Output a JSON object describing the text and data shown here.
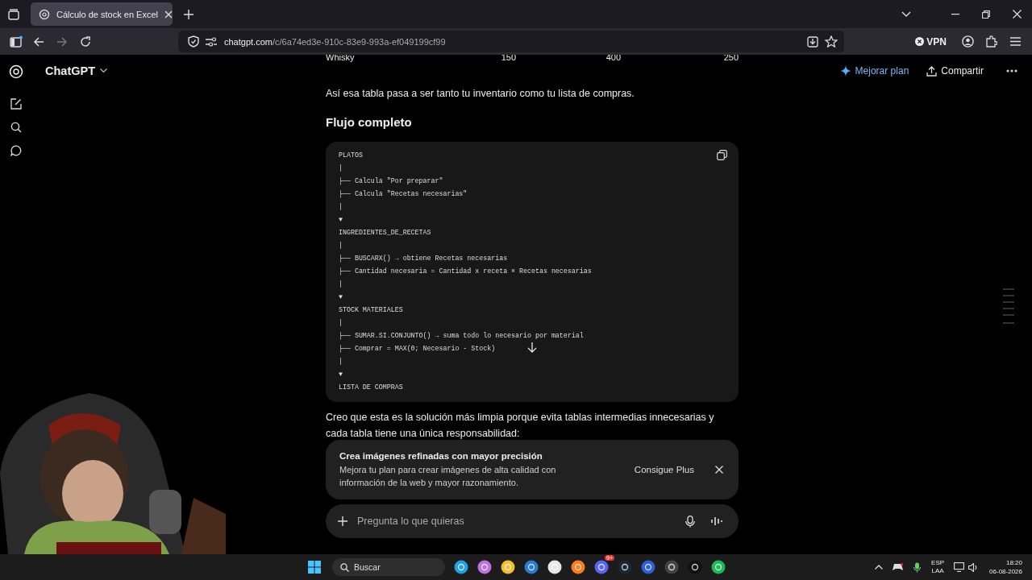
{
  "browser": {
    "tab_title": "Cálculo de stock en Excel",
    "url_domain": "chatgpt.com",
    "url_path": "/c/6a74ed3e-910c-83e9-993a-ef049199cf99",
    "vpn_label": "VPN",
    "forward_disabled": true
  },
  "header": {
    "model": "ChatGPT",
    "upgrade": "Mejorar plan",
    "share": "Compartir"
  },
  "table_row": [
    "Whisky",
    "150",
    "400",
    "250"
  ],
  "paragraph_1": "Así esa tabla pasa a ser tanto tu inventario como tu lista de compras.",
  "heading": "Flujo completo",
  "code_lines": [
    "PLATOS",
    "|",
    "├── Calcula \"Por preparar\"",
    "├── Calcula \"Recetas necesarias\"",
    "|",
    "▼",
    "INGREDIENTES_DE_RECETAS",
    "|",
    "├── BUSCARX() → obtiene Recetas necesarias",
    "├── Cantidad necesaria = Cantidad x receta × Recetas necesarias",
    "|",
    "▼",
    "STOCK MATERIALES",
    "|",
    "├── SUMAR.SI.CONJUNTO() → suma todo lo necesario por material",
    "├── Comprar = MAX(0; Necesario - Stock)",
    "|",
    "▼",
    "LISTA DE COMPRAS"
  ],
  "paragraph_2": "Creo que esta es la solución más limpia porque evita tablas intermedias innecesarias y cada tabla tiene una única responsabilidad:",
  "banner": {
    "title": "Crea imágenes refinadas con mayor precisión",
    "body": "Mejora tu plan para crear imágenes de alta calidad con información de la web y mayor razonamiento.",
    "action": "Consigue Plus"
  },
  "composer": {
    "placeholder": "Pregunta lo que quieras"
  },
  "taskbar": {
    "search_placeholder": "Buscar",
    "badge": "9+",
    "language": "ESP",
    "layout": "LAA",
    "time": "18:20",
    "date": "06-08-2026"
  }
}
